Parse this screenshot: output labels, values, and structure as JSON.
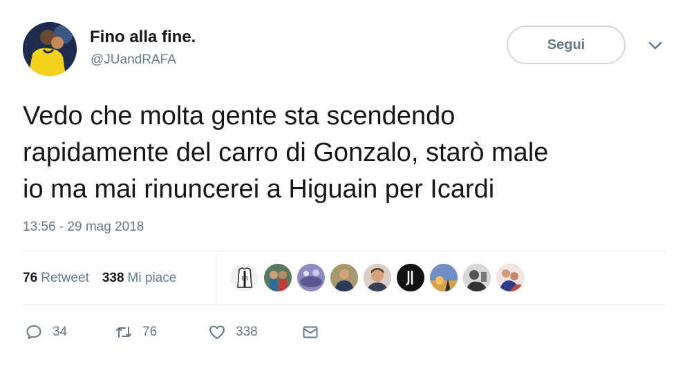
{
  "author": {
    "name": "Fino alla fine.",
    "handle": "@JUandRAFA",
    "avatar_icon": "player-avatar-icon"
  },
  "follow_button": {
    "label": "Segui"
  },
  "tweet": {
    "lines": [
      "Vedo che molta gente sta scendendo",
      "rapidamente del carro di Gonzalo, starò male",
      "io ma mai rinuncerei a Higuain per Icardi"
    ],
    "timestamp": "13:56 - 29 mag 2018"
  },
  "stats": {
    "retweets_count": "76",
    "retweets_label": "Retweet",
    "likes_count": "338",
    "likes_label": "Mi piace"
  },
  "likers": [
    {
      "icon": "jersey-avatar-icon",
      "color": "#e9e9e9"
    },
    {
      "icon": "team-photo-avatar-icon",
      "color": "#6f8a6a"
    },
    {
      "icon": "stadium-avatar-icon",
      "color": "#8a86b8"
    },
    {
      "icon": "player-avatar-icon",
      "color": "#b8ab7c"
    },
    {
      "icon": "portrait-avatar-icon",
      "color": "#a0674f"
    },
    {
      "icon": "juventus-logo-avatar-icon",
      "color": "#111111"
    },
    {
      "icon": "sunset-avatar-icon",
      "color": "#6b88b8"
    },
    {
      "icon": "bw-photo-avatar-icon",
      "color": "#8f8f8f"
    },
    {
      "icon": "crowd-avatar-icon",
      "color": "#c4473b"
    }
  ],
  "actions": {
    "replies": "34",
    "retweets": "76",
    "likes": "338"
  },
  "colors": {
    "text": "#14171a",
    "secondary": "#657786",
    "divider": "#e6ecf0"
  }
}
